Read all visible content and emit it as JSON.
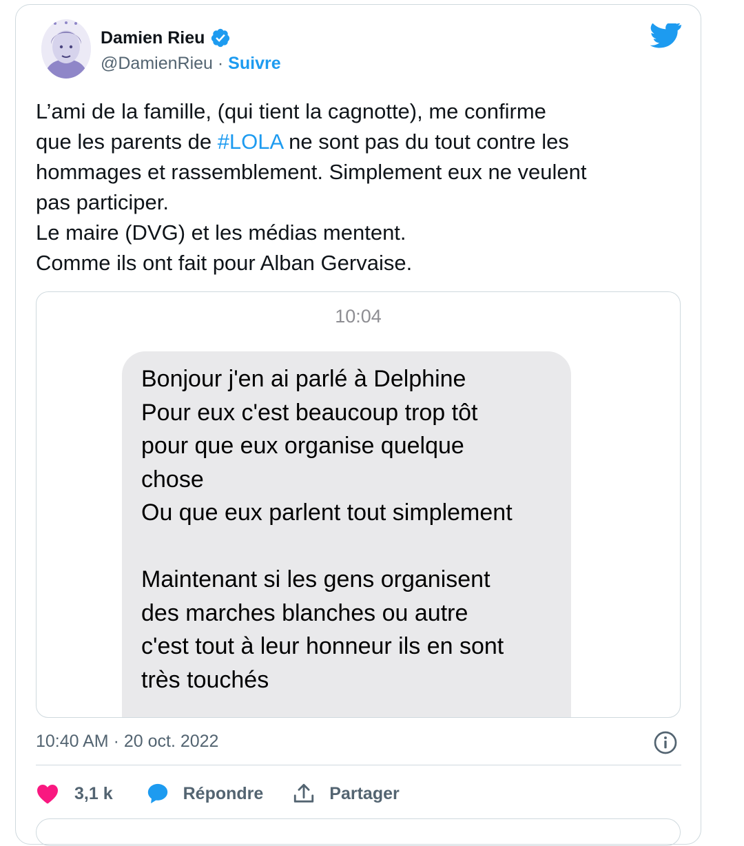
{
  "author": {
    "display_name": "Damien Rieu",
    "handle": "@DamienRieu",
    "separator": " · ",
    "follow_label": "Suivre"
  },
  "tweet": {
    "text_part1": "L’ami de la famille, (qui tient la cagnotte), me confirme\nque les parents de ",
    "hashtag": "#LOLA",
    "text_part2": " ne sont pas du tout contre les\nhommages et rassemblement. Simplement eux ne veulent\npas participer.\nLe maire (DVG) et les médias mentent.\nComme ils ont fait pour Alban Gervaise."
  },
  "media": {
    "message_time": "10:04",
    "message_text": "Bonjour j'en ai parlé à Delphine\nPour eux c'est beaucoup trop tôt\npour que eux organise quelque\nchose\nOu que eux parlent tout simplement\n\nMaintenant si les gens organisent\ndes marches blanches ou autre\nc'est tout à leur honneur ils en sont\ntrès touchés"
  },
  "meta": {
    "timestamp": "10:40 AM · 20 oct. 2022"
  },
  "actions": {
    "like_count": "3,1 k",
    "reply_label": "Répondre",
    "share_label": "Partager"
  },
  "colors": {
    "twitter_blue": "#1d9bf0",
    "like_pink": "#f91880",
    "text_primary": "#0f1419",
    "text_secondary": "#536471",
    "bubble_gray": "#e9e9eb"
  }
}
